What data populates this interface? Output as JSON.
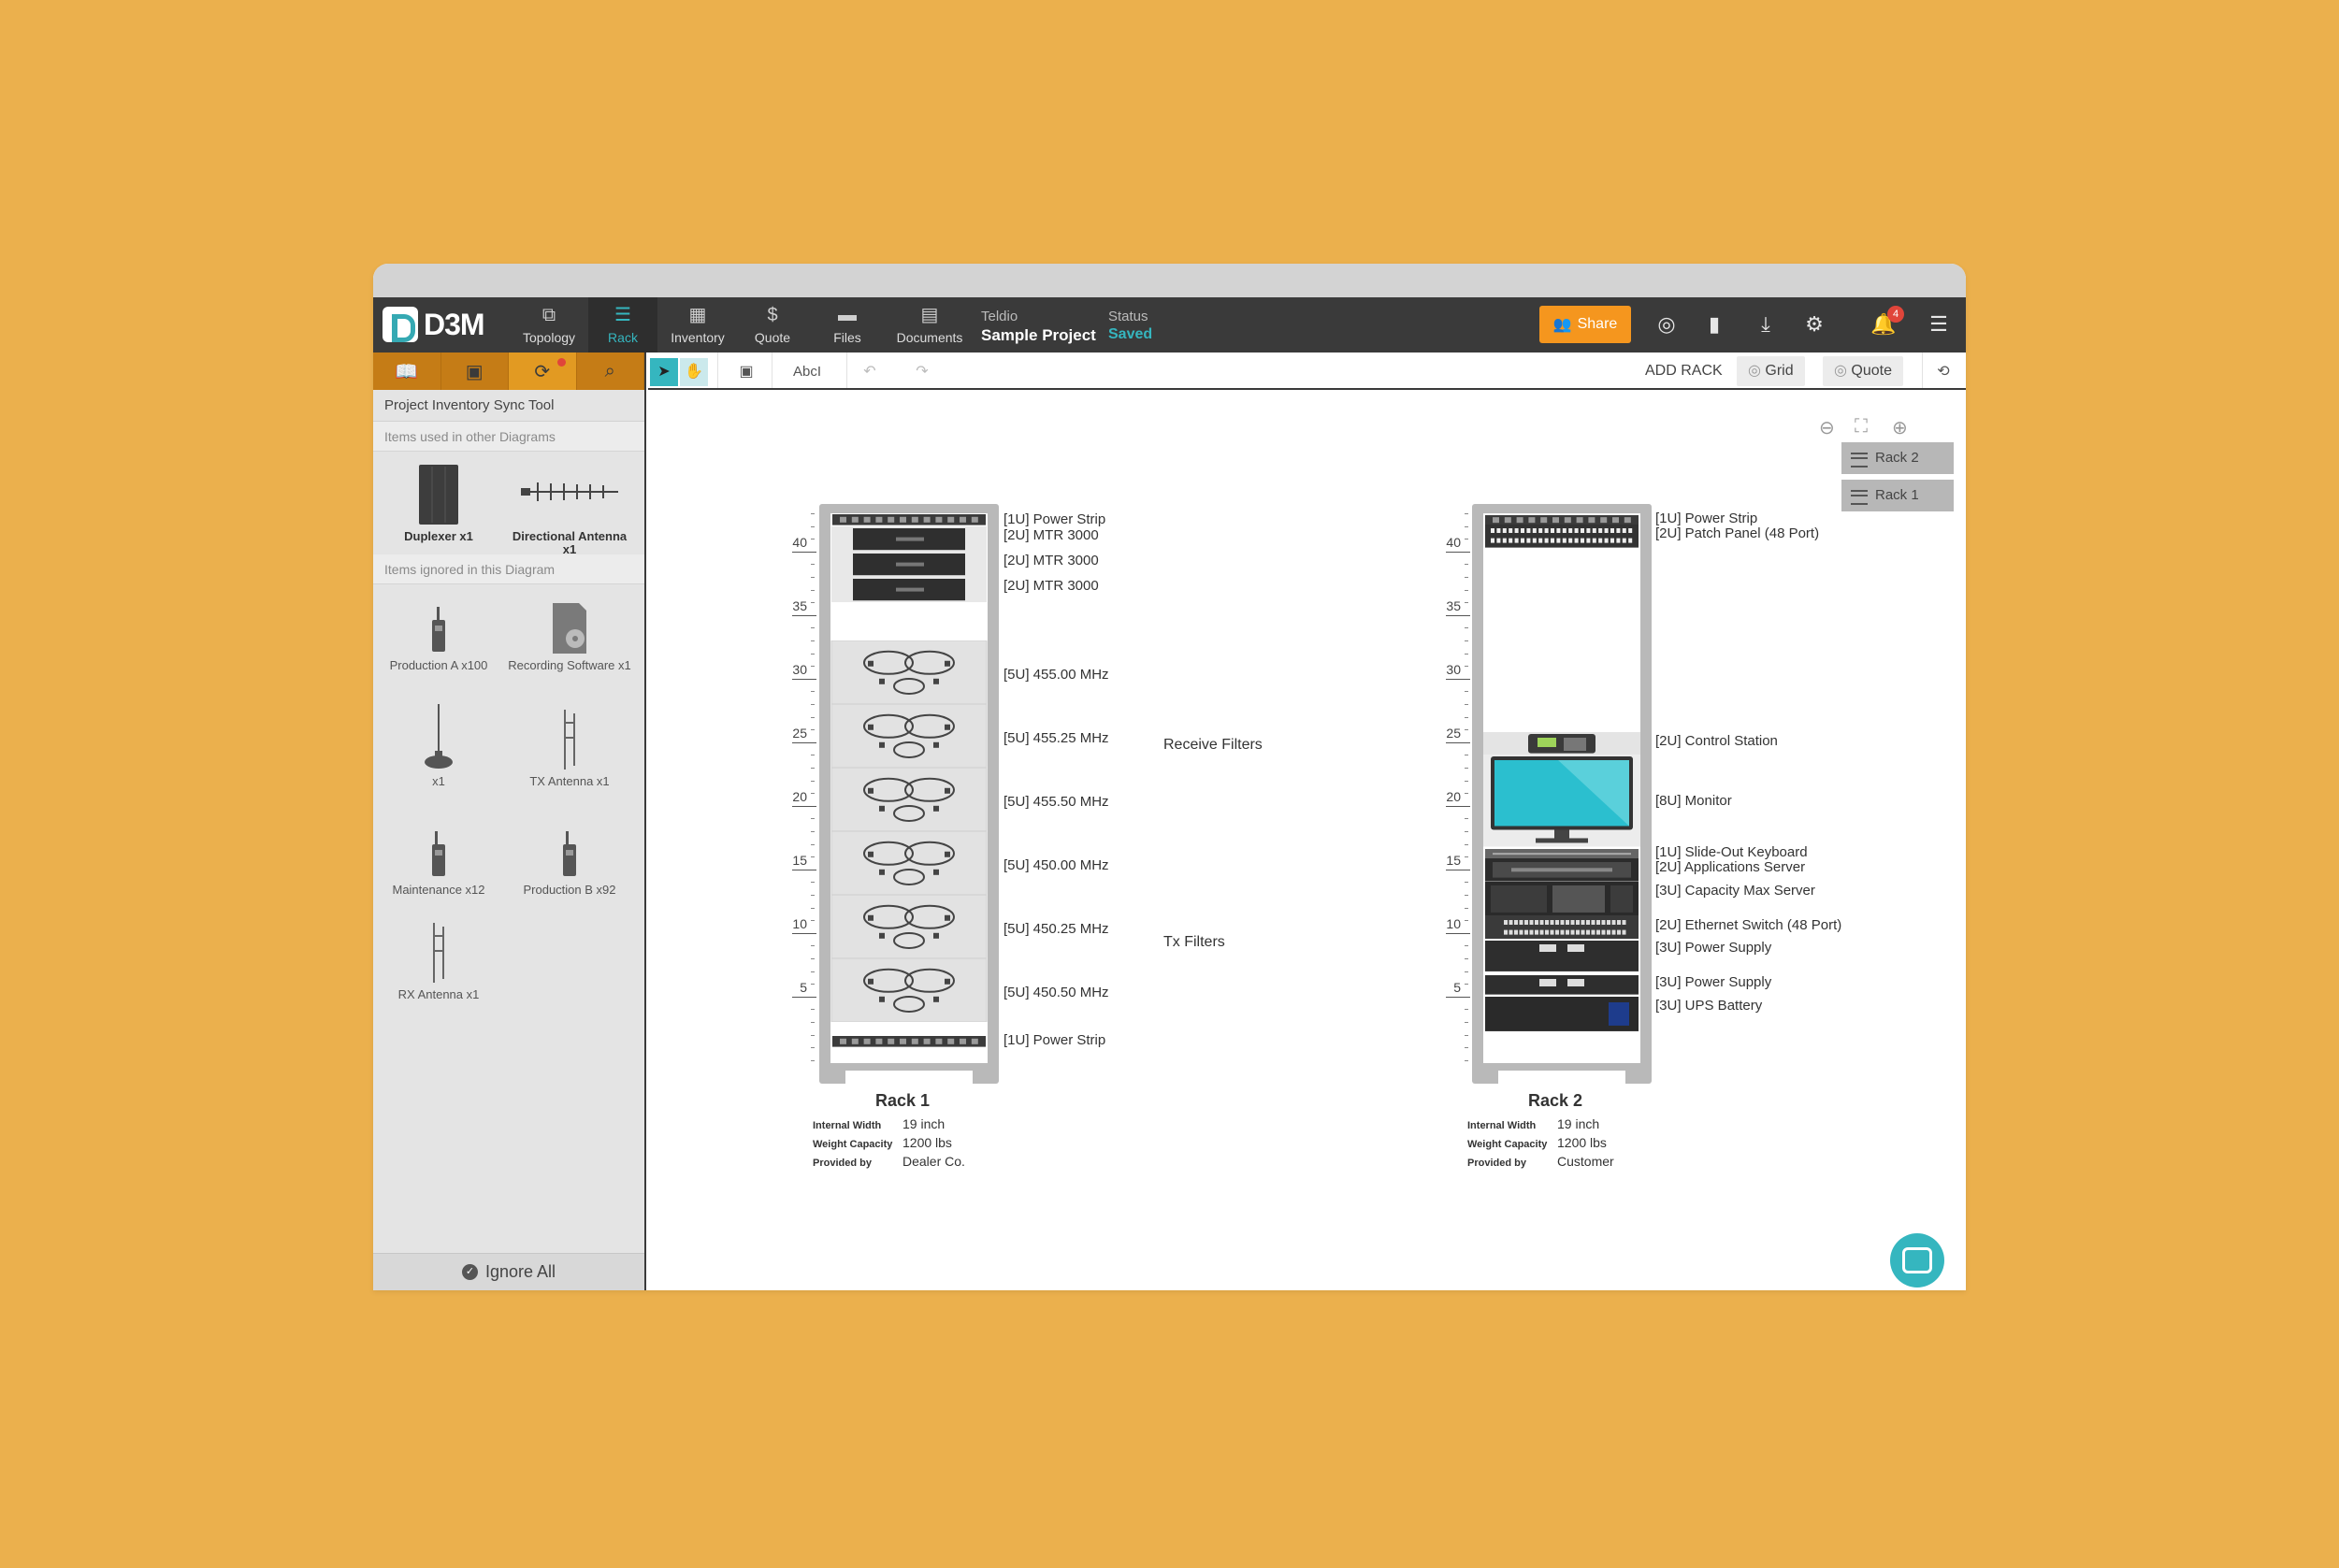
{
  "colors": {
    "background": "#ebb04d",
    "accent": "#35b6bf",
    "share": "#f5961e",
    "sidebar_tabs": "#c57c16"
  },
  "app": {
    "logo_text": "D3M"
  },
  "nav": {
    "items": [
      {
        "label": "Topology",
        "icon": "topology-icon"
      },
      {
        "label": "Rack",
        "icon": "rack-icon"
      },
      {
        "label": "Inventory",
        "icon": "inventory-icon"
      },
      {
        "label": "Quote",
        "icon": "dollar-icon"
      },
      {
        "label": "Files",
        "icon": "folder-icon"
      },
      {
        "label": "Documents",
        "icon": "documents-icon"
      }
    ],
    "active": "Rack"
  },
  "project": {
    "org": "Teldio",
    "name": "Sample Project",
    "status_label": "Status",
    "status_value": "Saved"
  },
  "topbar": {
    "share_label": "Share",
    "notification_count": "4"
  },
  "sidebar": {
    "title": "Project Inventory Sync Tool",
    "section_used": "Items used in other Diagrams",
    "section_ignored": "Items ignored in this Diagram",
    "used_items": [
      {
        "label": "Duplexer x1",
        "icon": "duplexer-icon"
      },
      {
        "label": "Directional Antenna x1",
        "icon": "directional-antenna-icon"
      }
    ],
    "ignored_items": [
      {
        "label": "Production A x100",
        "icon": "portable-radio-icon"
      },
      {
        "label": "Recording Software x1",
        "icon": "software-box-icon"
      },
      {
        "label": "x1",
        "icon": "mobile-antenna-icon"
      },
      {
        "label": "TX Antenna x1",
        "icon": "antenna-icon"
      },
      {
        "label": "Maintenance x12",
        "icon": "portable-radio-icon"
      },
      {
        "label": "Production B x92",
        "icon": "portable-radio-icon"
      },
      {
        "label": "RX Antenna x1",
        "icon": "antenna-icon"
      }
    ],
    "ignore_all": "Ignore All"
  },
  "toolbar": {
    "text_tool": "AbcI",
    "add_rack": "ADD RACK",
    "grid": "Grid",
    "quote": "Quote"
  },
  "rack_list": [
    "Rack 2",
    "Rack 1"
  ],
  "ruler_labels": [
    "40",
    "35",
    "30",
    "25",
    "20",
    "15",
    "10",
    "5"
  ],
  "rack1": {
    "title": "Rack 1",
    "devices": [
      {
        "label": "[1U] Power Strip"
      },
      {
        "label": "[2U] MTR 3000"
      },
      {
        "label": "[2U] MTR 3000"
      },
      {
        "label": "[2U] MTR 3000"
      },
      {
        "label": "[5U] 455.00 MHz"
      },
      {
        "label": "[5U] 455.25 MHz"
      },
      {
        "label": "[5U] 455.50 MHz"
      },
      {
        "label": "[5U] 450.00 MHz"
      },
      {
        "label": "[5U] 450.25 MHz"
      },
      {
        "label": "[5U] 450.50 MHz"
      },
      {
        "label": "[1U] Power Strip"
      }
    ],
    "groups": [
      "Receive Filters",
      "Tx Filters"
    ],
    "specs": {
      "internal_width_k": "Internal Width",
      "internal_width": "19 inch",
      "weight_k": "Weight Capacity",
      "weight": "1200 lbs",
      "provided_k": "Provided by",
      "provided": "Dealer Co."
    }
  },
  "rack2": {
    "title": "Rack 2",
    "devices": [
      {
        "label": "[1U] Power Strip"
      },
      {
        "label": "[2U] Patch Panel (48 Port)"
      },
      {
        "label": "[2U] Control Station"
      },
      {
        "label": "[8U] Monitor"
      },
      {
        "label": "[1U] Slide-Out Keyboard"
      },
      {
        "label": "[2U] Applications Server"
      },
      {
        "label": "[3U] Capacity Max Server"
      },
      {
        "label": "[2U] Ethernet Switch (48 Port)"
      },
      {
        "label": "[3U] Power Supply"
      },
      {
        "label": "[3U] Power Supply"
      },
      {
        "label": "[3U] UPS Battery"
      }
    ],
    "specs": {
      "internal_width_k": "Internal Width",
      "internal_width": "19 inch",
      "weight_k": "Weight Capacity",
      "weight": "1200 lbs",
      "provided_k": "Provided by",
      "provided": "Customer"
    }
  }
}
